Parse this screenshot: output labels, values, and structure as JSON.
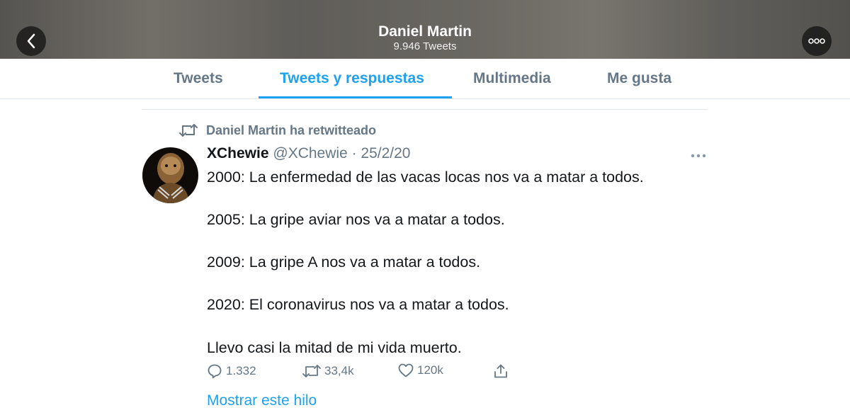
{
  "header": {
    "name": "Daniel Martin",
    "tweet_count": "9.946 Tweets",
    "back_icon": "chevron-left-icon",
    "more_icon": "more-horizontal-icon"
  },
  "tabs": [
    {
      "label": "Tweets",
      "active": false
    },
    {
      "label": "Tweets y respuestas",
      "active": true
    },
    {
      "label": "Multimedia",
      "active": false
    },
    {
      "label": "Me gusta",
      "active": false
    }
  ],
  "tweet": {
    "retweet_context": "Daniel Martin ha retwitteado",
    "author_name": "XChewie",
    "author_handle": "@XChewie",
    "separator": "·",
    "date": "25/2/20",
    "lines": [
      "2000: La enfermedad de las vacas locas nos va a matar a todos.",
      "2005: La gripe aviar nos va a matar a todos.",
      "2009: La gripe A nos va a matar a todos.",
      "2020: El coronavirus nos va a matar a todos.",
      "Llevo casi la mitad de mi vida muerto."
    ],
    "replies": "1.332",
    "retweets": "33,4k",
    "likes": "120k",
    "show_thread": "Mostrar este hilo"
  },
  "colors": {
    "accent": "#1da1f2",
    "secondary_text": "#657786",
    "primary_text": "#14171a"
  }
}
